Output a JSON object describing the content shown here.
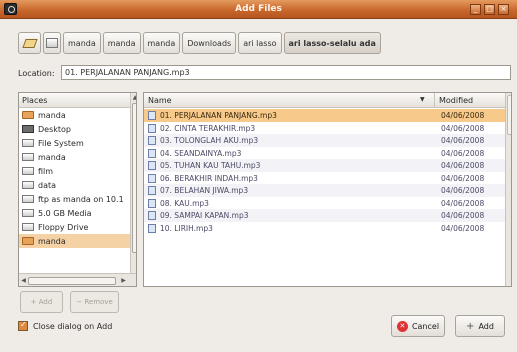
{
  "window": {
    "title": "Add Files"
  },
  "pathbar": {
    "buttons": [
      "manda",
      "manda",
      "manda",
      "Downloads",
      "ari lasso",
      "ari lasso-selalu ada"
    ],
    "active_index": 5
  },
  "location": {
    "label": "Location:",
    "value": "01. PERJALANAN PANJANG.mp3"
  },
  "places": {
    "header": "Places",
    "items": [
      {
        "label": "manda",
        "icon": "folder-icon"
      },
      {
        "label": "Desktop",
        "icon": "desktop-icon"
      },
      {
        "label": "File System",
        "icon": "drive-icon"
      },
      {
        "label": "manda",
        "icon": "drive-icon"
      },
      {
        "label": "film",
        "icon": "drive-icon"
      },
      {
        "label": "data",
        "icon": "drive-icon"
      },
      {
        "label": "ftp as manda on 10.1",
        "icon": "drive-icon"
      },
      {
        "label": "5.0 GB Media",
        "icon": "drive-icon"
      },
      {
        "label": "Floppy Drive",
        "icon": "drive-icon"
      },
      {
        "label": "manda",
        "icon": "folder-icon"
      }
    ],
    "selected_index": 9,
    "add_label": "Add",
    "remove_label": "Remove"
  },
  "files": {
    "name_header": "Name",
    "modified_header": "Modified",
    "rows": [
      {
        "name": "01. PERJALANAN PANJANG.mp3",
        "modified": "04/06/2008"
      },
      {
        "name": "02. CINTA TERAKHIR.mp3",
        "modified": "04/06/2008"
      },
      {
        "name": "03. TOLONGLAH AKU.mp3",
        "modified": "04/06/2008"
      },
      {
        "name": "04. SEANDAINYA.mp3",
        "modified": "04/06/2008"
      },
      {
        "name": "05. TUHAN KAU TAHU.mp3",
        "modified": "04/06/2008"
      },
      {
        "name": "06. BERAKHIR INDAH.mp3",
        "modified": "04/06/2008"
      },
      {
        "name": "07. BELAHAN JIWA.mp3",
        "modified": "04/06/2008"
      },
      {
        "name": "08. KAU.mp3",
        "modified": "04/06/2008"
      },
      {
        "name": "09. SAMPAI KAPAN.mp3",
        "modified": "04/06/2008"
      },
      {
        "name": "10. LIRIH.mp3",
        "modified": "04/06/2008"
      }
    ],
    "selected_index": 0
  },
  "footer": {
    "close_dialog_label": "Close dialog on Add",
    "close_dialog_checked": true,
    "cancel_label": "Cancel",
    "add_label": "Add"
  },
  "colors": {
    "title_bar": "#c7652a",
    "selection": "#f7c98a",
    "check_accent": "#e0893e"
  }
}
